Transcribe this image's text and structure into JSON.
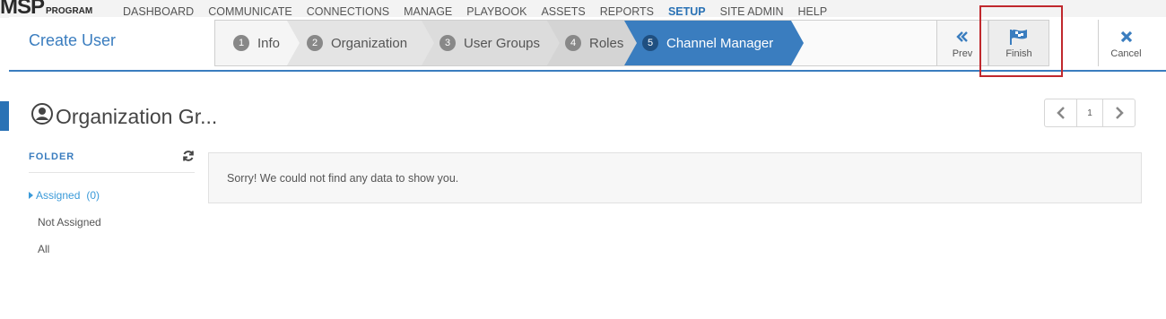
{
  "background": {
    "logo_main": "MSP",
    "logo_sub": "PROGRAM",
    "nav": [
      "DASHBOARD",
      "COMMUNICATE",
      "CONNECTIONS",
      "MANAGE",
      "PLAYBOOK",
      "ASSETS",
      "REPORTS",
      "SETUP",
      "SITE ADMIN",
      "HELP"
    ],
    "active_nav": "SETUP"
  },
  "modal": {
    "title": "Create User",
    "steps": [
      {
        "num": "1",
        "label": "Info"
      },
      {
        "num": "2",
        "label": "Organization"
      },
      {
        "num": "3",
        "label": "User Groups"
      },
      {
        "num": "4",
        "label": "Roles"
      },
      {
        "num": "5",
        "label": "Channel Manager"
      }
    ],
    "active_step": "5",
    "prev_label": "Prev",
    "finish_label": "Finish",
    "cancel_label": "Cancel"
  },
  "section": {
    "title": "Organization Gr..."
  },
  "pager": {
    "page": "1"
  },
  "folder": {
    "heading": "FOLDER",
    "items": [
      {
        "label": "Assigned",
        "count": "(0)"
      },
      {
        "label": "Not Assigned"
      },
      {
        "label": "All"
      }
    ]
  },
  "results": {
    "empty_message": "Sorry! We could not find any data to show you."
  },
  "colors": {
    "accent": "#3a7dbf",
    "highlight": "#c0282d",
    "link": "#3a9ad9"
  }
}
